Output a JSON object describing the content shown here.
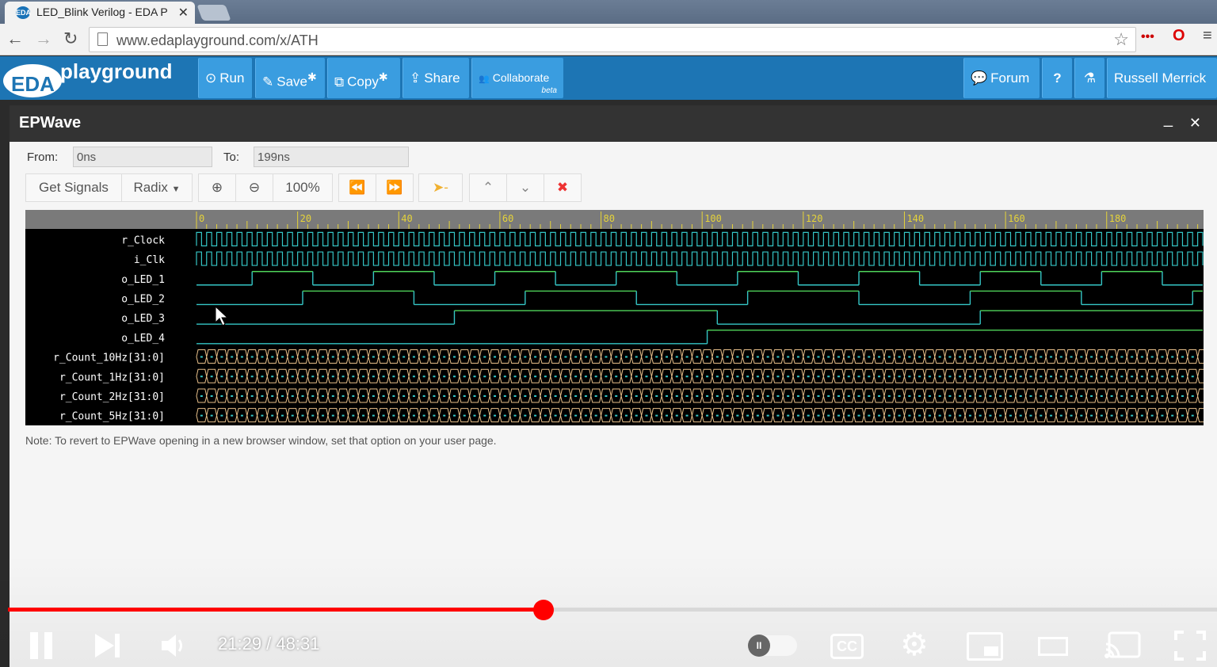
{
  "browser": {
    "tab_title": "LED_Blink Verilog - EDA P",
    "tab_favicon": "EDA",
    "url": "www.edaplayground.com/x/ATH",
    "icons": [
      "back-arrow-icon",
      "forward-arrow-icon",
      "reload-icon",
      "document-icon",
      "star-icon",
      "extension-dots-icon",
      "opera-icon",
      "menu-icon"
    ]
  },
  "header": {
    "logo_eda": "EDA",
    "logo_text": "playground",
    "buttons": [
      {
        "label": "Run",
        "icon": "⊙"
      },
      {
        "label": "Save",
        "icon": "✎",
        "suffix": "✱"
      },
      {
        "label": "Copy",
        "icon": "⧉",
        "suffix": "✱"
      },
      {
        "label": "Share",
        "icon": "⇪"
      },
      {
        "label": "Collaborate",
        "icon": "👥",
        "badge": "beta"
      }
    ],
    "right": {
      "forum": "Forum",
      "help": "?",
      "flask": "⚗",
      "user": "Russell Merrick"
    }
  },
  "epwave": {
    "title": "EPWave",
    "from_label": "From:",
    "from_value": "0ns",
    "to_label": "To:",
    "to_value": "199ns",
    "get_signals": "Get Signals",
    "radix": "Radix",
    "zoom": "100%",
    "note": "Note: To revert to EPWave opening in a new browser window, set that option on your user page."
  },
  "chart_data": {
    "type": "waveform",
    "x_ticks": [
      "0",
      "20",
      "40",
      "60",
      "80",
      "100",
      "120",
      "140",
      "160",
      "180"
    ],
    "xlim": [
      0,
      199
    ],
    "signals": [
      {
        "name": "r_Clock",
        "kind": "clock",
        "period": 2
      },
      {
        "name": "i_Clk",
        "kind": "clock",
        "period": 2
      },
      {
        "name": "o_LED_1",
        "kind": "digital",
        "transitions": [
          11,
          23,
          35,
          47,
          59,
          71,
          83,
          95,
          107,
          119,
          131,
          143,
          155,
          167,
          179,
          191
        ],
        "init": 0
      },
      {
        "name": "o_LED_2",
        "kind": "digital",
        "transitions": [
          21,
          43,
          65,
          87,
          109,
          131,
          153,
          175,
          197
        ],
        "init": 0
      },
      {
        "name": "o_LED_3",
        "kind": "digital",
        "transitions": [
          51,
          103,
          155
        ],
        "init": 0
      },
      {
        "name": "o_LED_4",
        "kind": "digital",
        "transitions": [
          101
        ],
        "init": 0
      },
      {
        "name": "r_Count_10Hz[31:0]",
        "kind": "bus"
      },
      {
        "name": "r_Count_1Hz[31:0]",
        "kind": "bus"
      },
      {
        "name": "r_Count_2Hz[31:0]",
        "kind": "bus"
      },
      {
        "name": "r_Count_5Hz[31:0]",
        "kind": "bus"
      }
    ],
    "colors": {
      "wave": "#35c6c6",
      "high": "#4fd45a",
      "bus": "#e8c08a",
      "ruler": "#e5d33a"
    }
  },
  "player": {
    "time": "21:29 / 48:31",
    "progress_fraction": 0.443
  }
}
